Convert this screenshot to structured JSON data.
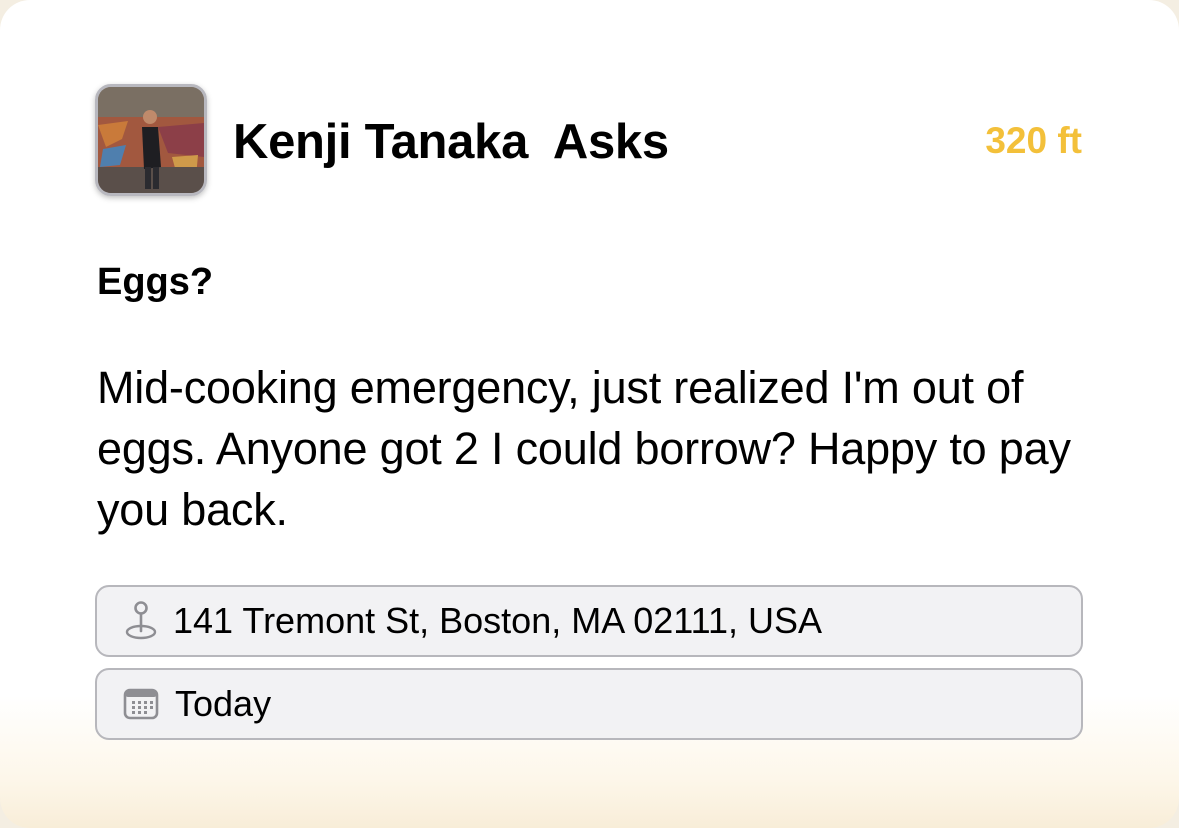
{
  "request": {
    "user_name": "Kenji Tanaka",
    "verb": "Asks",
    "distance": "320 ft",
    "title": "Eggs?",
    "description": "Mid-cooking emergency, just realized I'm out of eggs. Anyone got 2 I could borrow? Happy to pay you back.",
    "location": "141 Tremont St, Boston, MA 02111, USA",
    "date": "Today"
  },
  "icons": {
    "location": "location-pin-icon",
    "date": "calendar-icon"
  },
  "colors": {
    "distance": "#f3c03a",
    "pill_background": "#f2f2f4",
    "pill_border": "#b7b7bc"
  }
}
